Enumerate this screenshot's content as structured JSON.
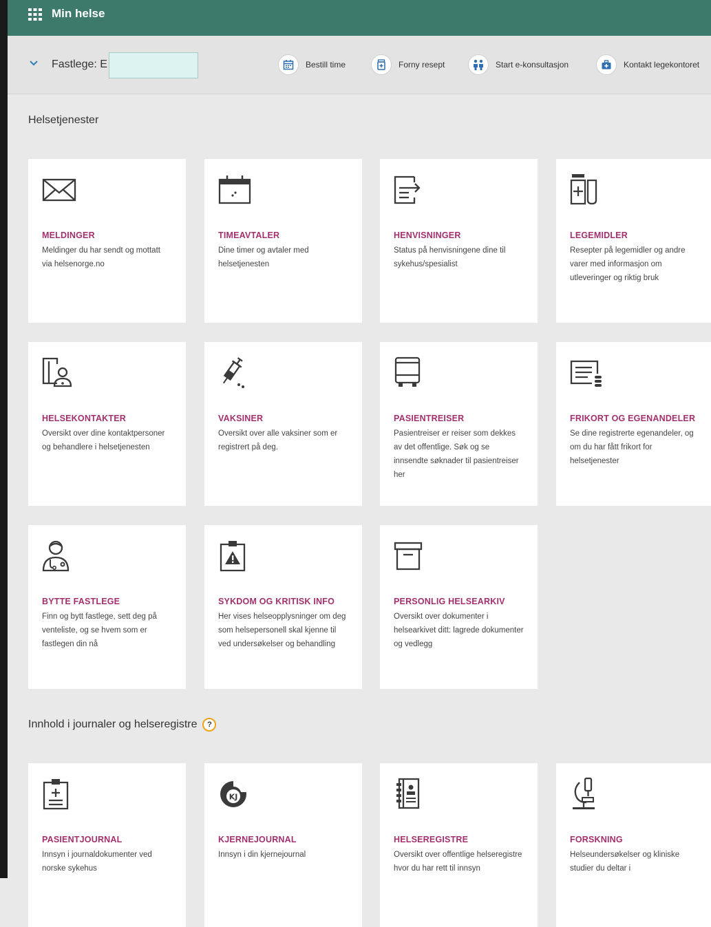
{
  "header": {
    "app_title": "Min helse",
    "icon": "apps-grid-icon"
  },
  "gp_bar": {
    "label": "Fastlege: E",
    "actions": [
      {
        "label": "Bestill time",
        "icon": "calendar-icon"
      },
      {
        "label": "Forny resept",
        "icon": "prescription-icon"
      },
      {
        "label": "Start e-konsultasjon",
        "icon": "people-icon"
      },
      {
        "label": "Kontakt legekontoret",
        "icon": "medical-kit-icon"
      }
    ]
  },
  "sections": {
    "services": {
      "title": "Helsetjenester",
      "cards": [
        {
          "title": "MELDINGER",
          "desc": "Meldinger du har sendt og mottatt via helsenorge.no",
          "icon": "envelope-icon"
        },
        {
          "title": "TIMEAVTALER",
          "desc": "Dine timer og avtaler med helsetjenesten",
          "icon": "calendar-icon"
        },
        {
          "title": "HENVISNINGER",
          "desc": "Status på henvisningene dine til sykehus/spesialist",
          "icon": "referral-document-icon"
        },
        {
          "title": "LEGEMIDLER",
          "desc": "Resepter på legemidler og andre varer med informasjon om utleveringer og riktig bruk",
          "icon": "medicine-icon"
        },
        {
          "title": "HELSEKONTAKTER",
          "desc": "Oversikt over dine kontaktpersoner og behandlere i helsetjenesten",
          "icon": "health-contact-icon"
        },
        {
          "title": "VAKSINER",
          "desc": "Oversikt over alle vaksiner som er registrert på deg.",
          "icon": "syringe-icon"
        },
        {
          "title": "PASIENTREISER",
          "desc": "Pasientreiser er reiser som dekkes av det offentlige. Søk og se innsendte søknader til pasientreiser her",
          "icon": "bus-icon"
        },
        {
          "title": "FRIKORT OG EGENANDELER",
          "desc": "Se dine registrerte egenandeler, og om du har fått frikort for helsetjenester",
          "icon": "exemption-card-icon"
        },
        {
          "title": "BYTTE FASTLEGE",
          "desc": "Finn og bytt fastlege, sett deg på venteliste, og se hvem som er fastlegen din nå",
          "icon": "doctor-icon"
        },
        {
          "title": "SYKDOM OG KRITISK INFO",
          "desc": "Her vises helseopplysninger om deg som helsepersonell skal kjenne til ved undersøkelser og behandling",
          "icon": "critical-info-icon"
        },
        {
          "title": "PERSONLIG HELSEARKIV",
          "desc": "Oversikt over dokumenter i helsearkivet ditt: lagrede dokumenter og vedlegg",
          "icon": "archive-box-icon"
        }
      ]
    },
    "records": {
      "title": "Innhold i journaler og helseregistre",
      "help_label": "?",
      "cards": [
        {
          "title": "PASIENTJOURNAL",
          "desc": "Innsyn i journaldokumenter ved norske sykehus",
          "icon": "clipboard-icon"
        },
        {
          "title": "KJERNEJOURNAL",
          "desc": "Innsyn i din kjernejournal",
          "icon": "kj-logo-icon"
        },
        {
          "title": "HELSEREGISTRE",
          "desc": "Oversikt over offentlige helseregistre hvor du har rett til innsyn",
          "icon": "registry-book-icon"
        },
        {
          "title": "FORSKNING",
          "desc": "Helseundersøkelser og kliniske studier du deltar i",
          "icon": "microscope-icon"
        }
      ]
    }
  },
  "colors": {
    "header": "#3d7a6b",
    "card_title": "#a3306e",
    "background": "#e9e9e9",
    "help_ring": "#f0a21a"
  }
}
